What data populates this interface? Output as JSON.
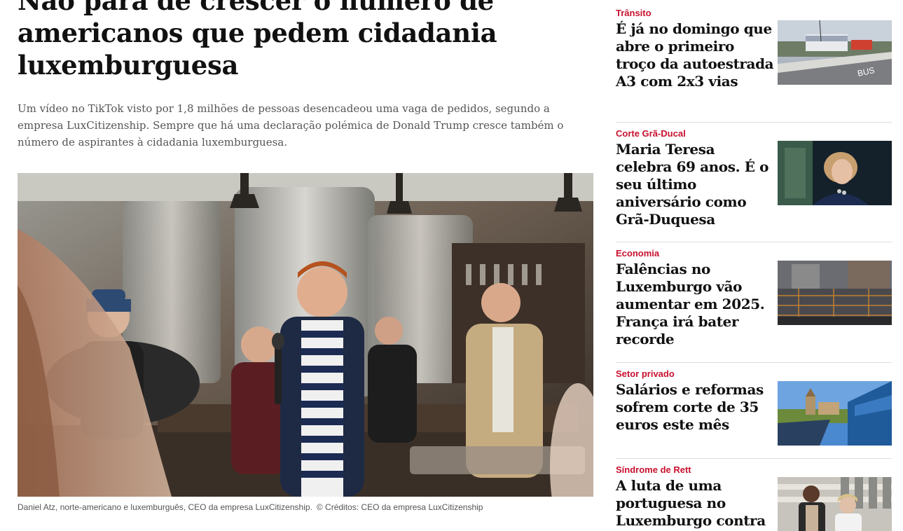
{
  "article": {
    "headline": "Não para de crescer o número de americanos que pedem cidadania luxemburguesa",
    "lead": "Um vídeo no TikTok visto por 1,8 milhões de pessoas desencadeou uma vaga de pedidos, segundo a empresa LuxCitizenship. Sempre que há uma declaração polémica de Donald Trump cresce também o número de aspirantes à cidadania luxemburguesa.",
    "caption": "Daniel Atz, norte-americano e luxemburguês, CEO da empresa LuxCitizenship.",
    "credit": "© Créditos: CEO da empresa LuxCitizenship"
  },
  "sidebar": {
    "stories": [
      {
        "category": "Trânsito",
        "title": "É já no domingo que abre o primeiro troço da autoestrada A3 com 2x3 vias"
      },
      {
        "category": "Corte Grã-Ducal",
        "title": "Maria Teresa celebra 69 anos. É o seu último aniversário como Grã-Duquesa"
      },
      {
        "category": "Economia",
        "title": "Falências no Luxemburgo vão aumentar em 2025. França irá bater recorde"
      },
      {
        "category": "Setor privado",
        "title": "Salários e reformas sofrem corte de 35 euros este mês"
      },
      {
        "category": "Síndrome de Rett",
        "title": "A luta de uma portuguesa no Luxemburgo contra"
      }
    ]
  },
  "colors": {
    "category": "#c8102e",
    "lead": "#555555",
    "divider": "#dddddd"
  }
}
